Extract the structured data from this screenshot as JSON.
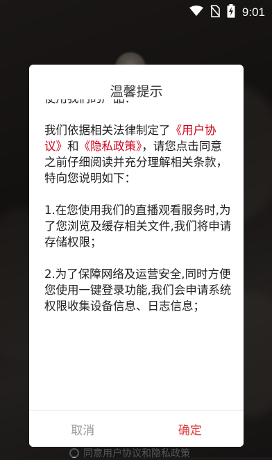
{
  "status_bar": {
    "time": "9:01",
    "icons": [
      "wifi-icon",
      "no-sim-icon",
      "battery-charging-icon"
    ]
  },
  "background": {
    "agree_text": "同意用户协议和隐私政策"
  },
  "dialog": {
    "title": "温馨提示",
    "cut_line": "使用我们的产品：",
    "p1_prefix": "我们依据相关法律制定了",
    "p1_link_user": "《用户协议》",
    "p1_and": "和",
    "p1_link_privacy": "《隐私政策》",
    "p1_suffix": "，请您点击同意之前仔细阅读并充分理解相关条款，特向您说明如下：",
    "p2": "1.在您使用我们的直播观看服务时,为了您浏览及缓存相关文件,我们将申请存储权限；",
    "p3": "2.为了保障网络及运营安全,同时方便您使用一键登录功能,我们会申请系统权限收集设备信息、日志信息；",
    "cancel_label": "取消",
    "confirm_label": "确定"
  },
  "colors": {
    "link": "#d0021b",
    "confirm": "#e03a3a",
    "cancel": "#999999"
  }
}
